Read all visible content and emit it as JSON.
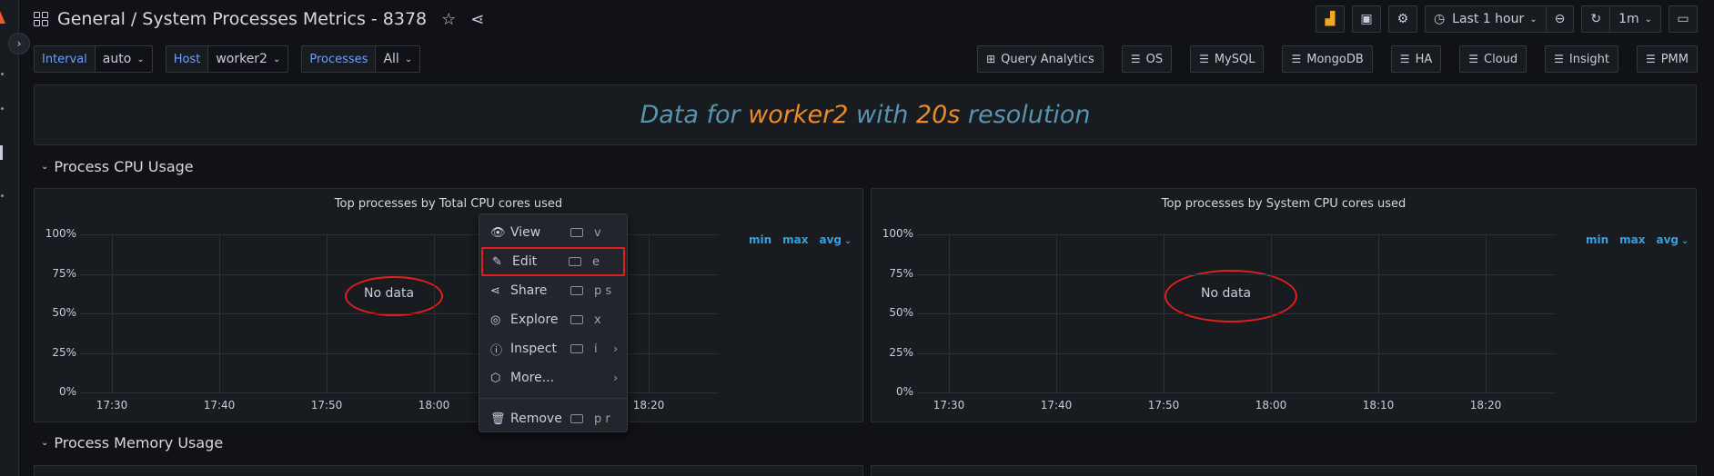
{
  "dashboard": {
    "section": "General",
    "separator": "/",
    "title": "System Processes Metrics - 8378"
  },
  "toolbar": {
    "time_range": "Last 1 hour",
    "refresh_interval": "1m"
  },
  "variables": [
    {
      "label": "Interval",
      "value": "auto"
    },
    {
      "label": "Host",
      "value": "worker2"
    },
    {
      "label": "Processes",
      "value": "All"
    }
  ],
  "links": [
    "Query Analytics",
    "OS",
    "MySQL",
    "MongoDB",
    "HA",
    "Cloud",
    "Insight",
    "PMM"
  ],
  "banner": {
    "part1": "Data for ",
    "host": "worker2",
    "part2": " with ",
    "resolution": "20s",
    "part3": " resolution"
  },
  "rows": {
    "cpu": "Process CPU Usage",
    "memory": "Process Memory Usage"
  },
  "panels": [
    {
      "title": "Top processes by Total CPU cores used",
      "no_data": "No data",
      "legend": [
        "min",
        "max",
        "avg"
      ]
    },
    {
      "title": "Top processes by System CPU cores used",
      "no_data": "No data",
      "legend": [
        "min",
        "max",
        "avg"
      ]
    }
  ],
  "axis": {
    "y_ticks": [
      "100%",
      "75%",
      "50%",
      "25%",
      "0%"
    ],
    "x_ticks": [
      "17:30",
      "17:40",
      "17:50",
      "18:00",
      "18:10",
      "18:20"
    ]
  },
  "context_menu": [
    {
      "icon": "eye-icon",
      "glyph": "👁",
      "label": "View",
      "key": "v"
    },
    {
      "icon": "edit-icon",
      "glyph": "✎",
      "label": "Edit",
      "key": "e"
    },
    {
      "icon": "share-icon",
      "glyph": "⋖",
      "label": "Share",
      "key": "p s"
    },
    {
      "icon": "compass-icon",
      "glyph": "◎",
      "label": "Explore",
      "key": "x"
    },
    {
      "icon": "info-icon",
      "glyph": "ⓘ",
      "label": "Inspect",
      "key": "i"
    },
    {
      "icon": "cube-icon",
      "glyph": "⬡",
      "label": "More...",
      "key": ""
    },
    {
      "icon": "trash-icon",
      "glyph": "🗑",
      "label": "Remove",
      "key": "p r"
    }
  ],
  "colors": {
    "accent_orange": "#eb8a26",
    "banner_blue": "#5794b0",
    "legend_blue": "#33a2e5",
    "annotation_red": "#e02020"
  }
}
